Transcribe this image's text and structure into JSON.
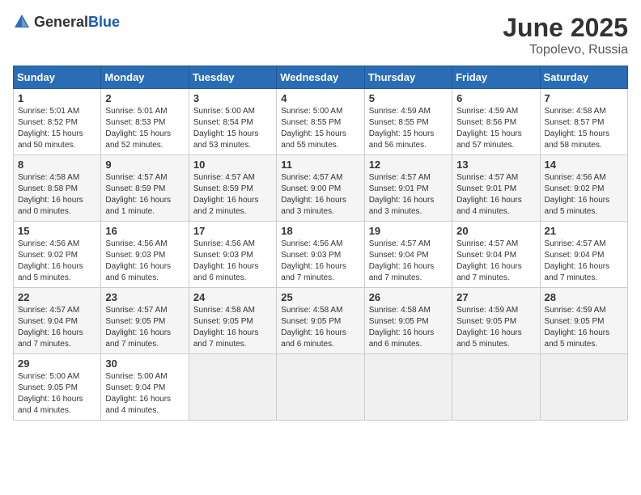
{
  "header": {
    "logo_general": "General",
    "logo_blue": "Blue",
    "title": "June 2025",
    "subtitle": "Topolevo, Russia"
  },
  "days_of_week": [
    "Sunday",
    "Monday",
    "Tuesday",
    "Wednesday",
    "Thursday",
    "Friday",
    "Saturday"
  ],
  "weeks": [
    [
      {
        "day": "1",
        "sunrise": "5:01 AM",
        "sunset": "8:52 PM",
        "daylight": "15 hours and 50 minutes."
      },
      {
        "day": "2",
        "sunrise": "5:01 AM",
        "sunset": "8:53 PM",
        "daylight": "15 hours and 52 minutes."
      },
      {
        "day": "3",
        "sunrise": "5:00 AM",
        "sunset": "8:54 PM",
        "daylight": "15 hours and 53 minutes."
      },
      {
        "day": "4",
        "sunrise": "5:00 AM",
        "sunset": "8:55 PM",
        "daylight": "15 hours and 55 minutes."
      },
      {
        "day": "5",
        "sunrise": "4:59 AM",
        "sunset": "8:55 PM",
        "daylight": "15 hours and 56 minutes."
      },
      {
        "day": "6",
        "sunrise": "4:59 AM",
        "sunset": "8:56 PM",
        "daylight": "15 hours and 57 minutes."
      },
      {
        "day": "7",
        "sunrise": "4:58 AM",
        "sunset": "8:57 PM",
        "daylight": "15 hours and 58 minutes."
      }
    ],
    [
      {
        "day": "8",
        "sunrise": "4:58 AM",
        "sunset": "8:58 PM",
        "daylight": "16 hours and 0 minutes."
      },
      {
        "day": "9",
        "sunrise": "4:57 AM",
        "sunset": "8:59 PM",
        "daylight": "16 hours and 1 minute."
      },
      {
        "day": "10",
        "sunrise": "4:57 AM",
        "sunset": "8:59 PM",
        "daylight": "16 hours and 2 minutes."
      },
      {
        "day": "11",
        "sunrise": "4:57 AM",
        "sunset": "9:00 PM",
        "daylight": "16 hours and 3 minutes."
      },
      {
        "day": "12",
        "sunrise": "4:57 AM",
        "sunset": "9:01 PM",
        "daylight": "16 hours and 3 minutes."
      },
      {
        "day": "13",
        "sunrise": "4:57 AM",
        "sunset": "9:01 PM",
        "daylight": "16 hours and 4 minutes."
      },
      {
        "day": "14",
        "sunrise": "4:56 AM",
        "sunset": "9:02 PM",
        "daylight": "16 hours and 5 minutes."
      }
    ],
    [
      {
        "day": "15",
        "sunrise": "4:56 AM",
        "sunset": "9:02 PM",
        "daylight": "16 hours and 5 minutes."
      },
      {
        "day": "16",
        "sunrise": "4:56 AM",
        "sunset": "9:03 PM",
        "daylight": "16 hours and 6 minutes."
      },
      {
        "day": "17",
        "sunrise": "4:56 AM",
        "sunset": "9:03 PM",
        "daylight": "16 hours and 6 minutes."
      },
      {
        "day": "18",
        "sunrise": "4:56 AM",
        "sunset": "9:03 PM",
        "daylight": "16 hours and 7 minutes."
      },
      {
        "day": "19",
        "sunrise": "4:57 AM",
        "sunset": "9:04 PM",
        "daylight": "16 hours and 7 minutes."
      },
      {
        "day": "20",
        "sunrise": "4:57 AM",
        "sunset": "9:04 PM",
        "daylight": "16 hours and 7 minutes."
      },
      {
        "day": "21",
        "sunrise": "4:57 AM",
        "sunset": "9:04 PM",
        "daylight": "16 hours and 7 minutes."
      }
    ],
    [
      {
        "day": "22",
        "sunrise": "4:57 AM",
        "sunset": "9:04 PM",
        "daylight": "16 hours and 7 minutes."
      },
      {
        "day": "23",
        "sunrise": "4:57 AM",
        "sunset": "9:05 PM",
        "daylight": "16 hours and 7 minutes."
      },
      {
        "day": "24",
        "sunrise": "4:58 AM",
        "sunset": "9:05 PM",
        "daylight": "16 hours and 7 minutes."
      },
      {
        "day": "25",
        "sunrise": "4:58 AM",
        "sunset": "9:05 PM",
        "daylight": "16 hours and 6 minutes."
      },
      {
        "day": "26",
        "sunrise": "4:58 AM",
        "sunset": "9:05 PM",
        "daylight": "16 hours and 6 minutes."
      },
      {
        "day": "27",
        "sunrise": "4:59 AM",
        "sunset": "9:05 PM",
        "daylight": "16 hours and 5 minutes."
      },
      {
        "day": "28",
        "sunrise": "4:59 AM",
        "sunset": "9:05 PM",
        "daylight": "16 hours and 5 minutes."
      }
    ],
    [
      {
        "day": "29",
        "sunrise": "5:00 AM",
        "sunset": "9:05 PM",
        "daylight": "16 hours and 4 minutes."
      },
      {
        "day": "30",
        "sunrise": "5:00 AM",
        "sunset": "9:04 PM",
        "daylight": "16 hours and 4 minutes."
      },
      null,
      null,
      null,
      null,
      null
    ]
  ]
}
